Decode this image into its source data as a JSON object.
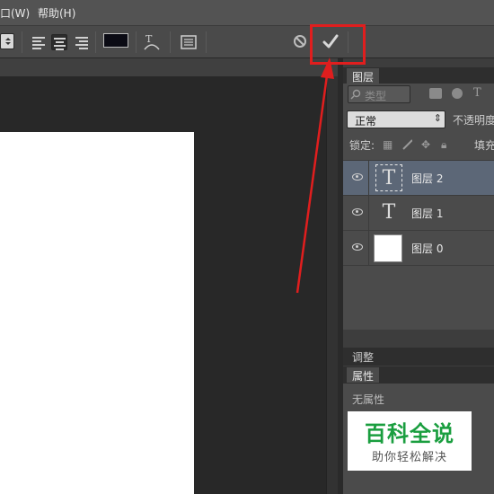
{
  "menu": {
    "window_label": "口(W)",
    "help_label": "帮助(H)"
  },
  "options_bar": {
    "text_color": "#0b0b14",
    "icons": [
      "dropdown-arrow",
      "align-left-icon",
      "align-center-icon",
      "align-right-icon",
      "warp-text-icon",
      "character-panel-icon",
      "cancel-icon",
      "commit-check-icon"
    ],
    "active_align": "center"
  },
  "annotation": {
    "color": "#e01e1e",
    "shape": "box-and-arrow"
  },
  "layers_panel": {
    "tab_label": "图层",
    "filter_label": "类型",
    "blend_mode": "正常",
    "opacity_label": "不透明度",
    "lock_label": "锁定:",
    "fill_label": "填充",
    "layers": [
      {
        "name": "图层 2",
        "thumb": "T",
        "kind": "text",
        "selected": true
      },
      {
        "name": "图层 1",
        "thumb": "T",
        "kind": "text",
        "selected": false
      },
      {
        "name": "图层 0",
        "thumb": "",
        "kind": "pixel",
        "selected": false
      }
    ]
  },
  "adjust_panel": {
    "tab_label": "调整"
  },
  "properties_panel": {
    "tab_label": "属性",
    "empty_text": "无属性"
  },
  "watermark": {
    "title": "百科全说",
    "subtitle": "助你轻松解决"
  }
}
